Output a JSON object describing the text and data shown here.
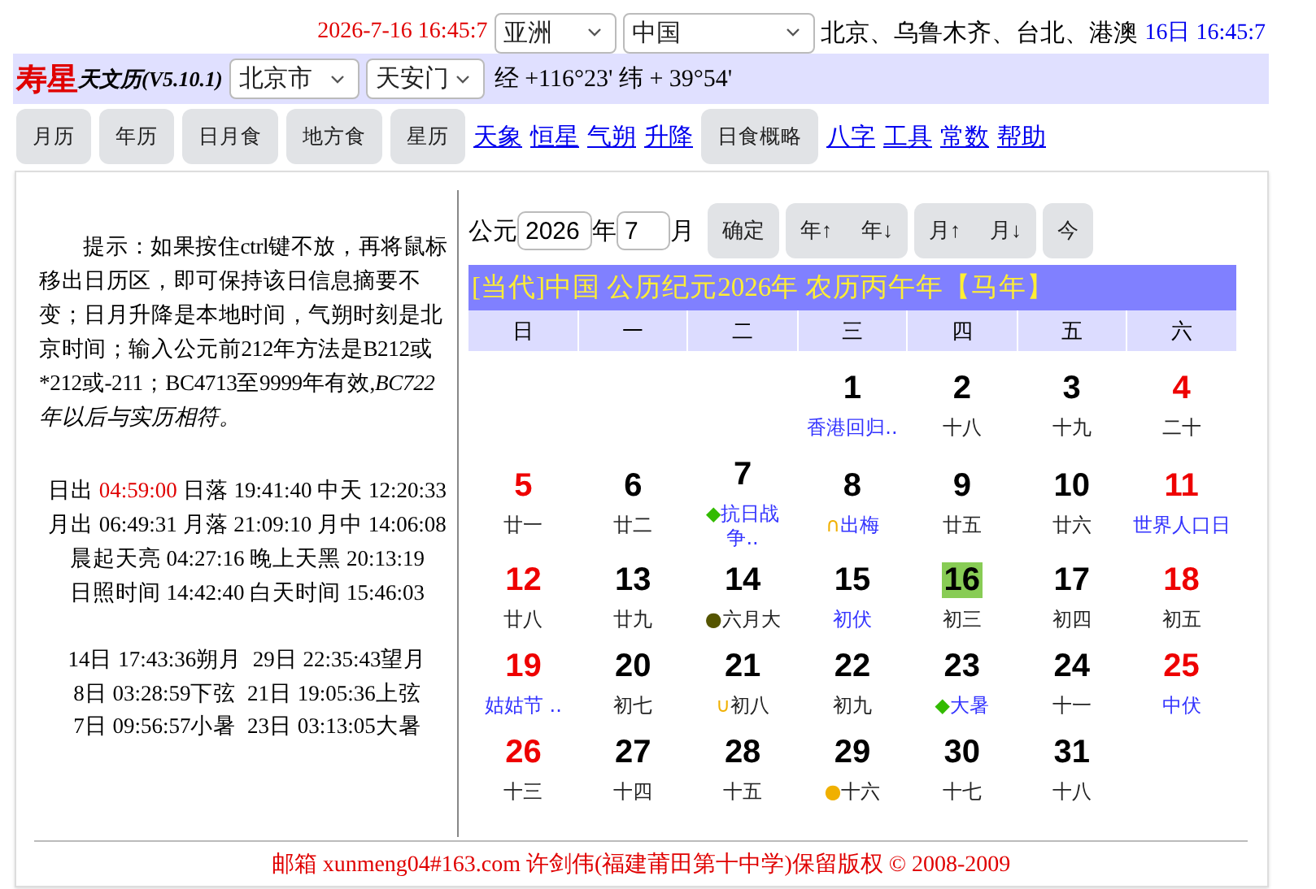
{
  "top": {
    "datetime": "2026-7-16 16:45:7",
    "continent": "亚洲",
    "country": "中国",
    "cities": "北京、乌鲁木齐、台北、港澳",
    "local_time": "16日 16:45:7"
  },
  "location_bar": {
    "brand": "寿星",
    "subtitle": "天文历(V5.10.1)",
    "city": "北京市",
    "spot": "天安门",
    "coords": "经 +116°23' 纬 + 39°54'"
  },
  "nav": [
    {
      "label": "月历",
      "kind": "button"
    },
    {
      "label": "年历",
      "kind": "button"
    },
    {
      "label": "日月食",
      "kind": "button"
    },
    {
      "label": "地方食",
      "kind": "button"
    },
    {
      "label": "星历",
      "kind": "button"
    },
    {
      "label": "天象",
      "kind": "link"
    },
    {
      "label": "恒星",
      "kind": "link"
    },
    {
      "label": "气朔",
      "kind": "link"
    },
    {
      "label": "升降",
      "kind": "link"
    },
    {
      "label": "日食概略",
      "kind": "button"
    },
    {
      "label": "八字",
      "kind": "link"
    },
    {
      "label": "工具",
      "kind": "link"
    },
    {
      "label": "常数",
      "kind": "link"
    },
    {
      "label": "帮助",
      "kind": "link"
    }
  ],
  "tip": "提示：如果按住ctrl键不放，再将鼠标移出日历区，即可保持该日信息摘要不变；日月升降是本地时间，气朔时刻是北京时间；输入公元前212年方法是B212或*212或-211；BC4713至9999年有效,*BC722年以后与实历相符。*",
  "sun_moon": [
    [
      {
        "text": "日出 ",
        "highlight": false
      },
      {
        "text": "04:59:00",
        "highlight": true
      },
      {
        "text": " 日落 19:41:40 中天 12:20:33",
        "highlight": false
      }
    ],
    [
      {
        "text": "月出 06:49:31 月落 21:09:10 月中 14:06:08",
        "highlight": false
      }
    ],
    [
      {
        "text": "晨起天亮 04:27:16 晚上天黑 20:13:19",
        "highlight": false
      }
    ],
    [
      {
        "text": "日照时间 14:42:40 白天时间 15:46:03",
        "highlight": false
      }
    ]
  ],
  "phases": [
    "14日 17:43:36朔月  29日 22:35:43望月",
    "8日 03:28:59下弦  21日 19:05:36上弦",
    "7日 09:56:57小暑  23日 03:13:05大暑"
  ],
  "controls": {
    "era": "公元",
    "year": "2026",
    "year_unit": "年",
    "month": "7",
    "month_unit": "月",
    "buttons": [
      [
        "确定"
      ],
      [
        "年↑",
        "年↓"
      ],
      [
        "月↑",
        "月↓"
      ],
      [
        "今"
      ]
    ]
  },
  "calendar": {
    "banner": "[当代]中国 公历纪元2026年 农历丙午年【马年】",
    "weekdays": [
      "日",
      "一",
      "二",
      "三",
      "四",
      "五",
      "六"
    ],
    "weeks": [
      [
        {
          "kind": "blank"
        },
        {
          "kind": "blank"
        },
        {
          "kind": "blank"
        },
        {
          "day": "1",
          "lunar": "香港回归..",
          "weekend": false,
          "festival": true,
          "selected": false
        },
        {
          "day": "2",
          "lunar": "十八",
          "weekend": false,
          "festival": false,
          "selected": false
        },
        {
          "day": "3",
          "lunar": "十九",
          "weekend": false,
          "festival": false,
          "selected": false
        },
        {
          "day": "4",
          "lunar": "二十",
          "weekend": true,
          "festival": false,
          "selected": false
        }
      ],
      [
        {
          "day": "5",
          "lunar": "廿一",
          "weekend": true,
          "festival": false,
          "selected": false
        },
        {
          "day": "6",
          "lunar": "廿二",
          "weekend": false,
          "festival": false,
          "selected": false
        },
        {
          "day": "7",
          "lunar": "抗日战争..",
          "weekend": false,
          "festival": true,
          "selected": false,
          "mark": {
            "symbol": "◆",
            "color": "#33bb00"
          }
        },
        {
          "day": "8",
          "lunar": "出梅",
          "weekend": false,
          "festival": true,
          "selected": false,
          "mark": {
            "symbol": "∩",
            "color": "#f0b000"
          }
        },
        {
          "day": "9",
          "lunar": "廿五",
          "weekend": false,
          "festival": false,
          "selected": false
        },
        {
          "day": "10",
          "lunar": "廿六",
          "weekend": false,
          "festival": false,
          "selected": false
        },
        {
          "day": "11",
          "lunar": "世界人口日",
          "weekend": true,
          "festival": true,
          "selected": false
        }
      ],
      [
        {
          "day": "12",
          "lunar": "廿八",
          "weekend": true,
          "festival": false,
          "selected": false
        },
        {
          "day": "13",
          "lunar": "廿九",
          "weekend": false,
          "festival": false,
          "selected": false
        },
        {
          "day": "14",
          "lunar": "六月大",
          "weekend": false,
          "festival": false,
          "selected": false,
          "mark": {
            "symbol": "●",
            "color": "#555500"
          }
        },
        {
          "day": "15",
          "lunar": "初伏",
          "weekend": false,
          "festival": true,
          "selected": false
        },
        {
          "day": "16",
          "lunar": "初三",
          "weekend": false,
          "festival": false,
          "selected": true
        },
        {
          "day": "17",
          "lunar": "初四",
          "weekend": false,
          "festival": false,
          "selected": false
        },
        {
          "day": "18",
          "lunar": "初五",
          "weekend": true,
          "festival": false,
          "selected": false
        }
      ],
      [
        {
          "day": "19",
          "lunar": "姑姑节 ..",
          "weekend": true,
          "festival": true,
          "selected": false
        },
        {
          "day": "20",
          "lunar": "初七",
          "weekend": false,
          "festival": false,
          "selected": false
        },
        {
          "day": "21",
          "lunar": "初八",
          "weekend": false,
          "festival": false,
          "selected": false,
          "mark": {
            "symbol": "∪",
            "color": "#f0b000"
          }
        },
        {
          "day": "22",
          "lunar": "初九",
          "weekend": false,
          "festival": false,
          "selected": false
        },
        {
          "day": "23",
          "lunar": "大暑",
          "weekend": false,
          "festival": true,
          "selected": false,
          "mark": {
            "symbol": "◆",
            "color": "#33bb00"
          }
        },
        {
          "day": "24",
          "lunar": "十一",
          "weekend": false,
          "festival": false,
          "selected": false
        },
        {
          "day": "25",
          "lunar": "中伏",
          "weekend": true,
          "festival": true,
          "selected": false
        }
      ],
      [
        {
          "day": "26",
          "lunar": "十三",
          "weekend": true,
          "festival": false,
          "selected": false
        },
        {
          "day": "27",
          "lunar": "十四",
          "weekend": false,
          "festival": false,
          "selected": false
        },
        {
          "day": "28",
          "lunar": "十五",
          "weekend": false,
          "festival": false,
          "selected": false
        },
        {
          "day": "29",
          "lunar": "十六",
          "weekend": false,
          "festival": false,
          "selected": false,
          "mark": {
            "symbol": "●",
            "color": "#f0b000"
          }
        },
        {
          "day": "30",
          "lunar": "十七",
          "weekend": false,
          "festival": false,
          "selected": false
        },
        {
          "day": "31",
          "lunar": "十八",
          "weekend": false,
          "festival": false,
          "selected": false
        },
        {
          "kind": "blank"
        }
      ]
    ]
  },
  "footer": "邮箱 xunmeng04#163.com 许剑伟(福建莆田第十中学)保留版权 © 2008-2009"
}
